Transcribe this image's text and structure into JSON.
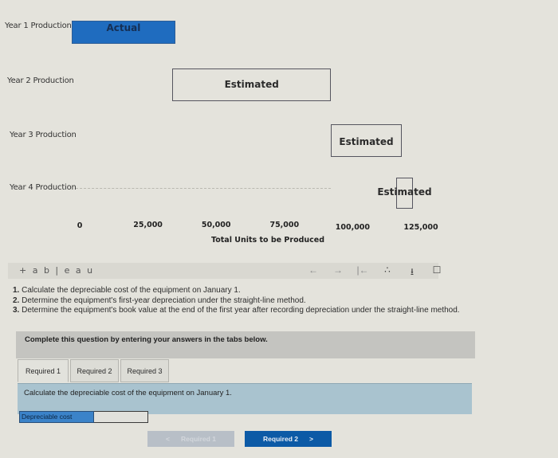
{
  "chart_data": {
    "type": "gantt",
    "title": "",
    "xlabel": "Total Units to be Produced",
    "ylabel": "",
    "xlim": [
      0,
      125000
    ],
    "x_ticks": [
      0,
      25000,
      50000,
      75000,
      100000,
      125000
    ],
    "x_tick_labels": [
      "0",
      "25,000",
      "50,000",
      "75,000",
      "100,000",
      "125,000"
    ],
    "categories": [
      "Year 1 Production",
      "Year 2 Production",
      "Year 3 Production",
      "Year 4 Production"
    ],
    "series": [
      {
        "category": "Year 1 Production",
        "label": "Actual",
        "start": 0,
        "end": 35000,
        "color": "#1f6cbf"
      },
      {
        "category": "Year 2 Production",
        "label": "Estimated",
        "start": 34000,
        "end": 92000,
        "color": "none"
      },
      {
        "category": "Year 3 Production",
        "label": "Estimated",
        "start": 92000,
        "end": 118000,
        "color": "none"
      },
      {
        "category": "Year 4 Production",
        "label": "Estimated",
        "start": 116000,
        "end": 122000,
        "color": "none"
      }
    ],
    "grid": false,
    "legend": "none"
  },
  "tableau": {
    "logo_text": "+ a b | e a u",
    "toolbar": [
      {
        "name": "undo-icon",
        "glyph": "←"
      },
      {
        "name": "redo-icon",
        "glyph": "→"
      },
      {
        "name": "revert-icon",
        "glyph": "|←"
      },
      {
        "name": "share-icon",
        "glyph": "∴"
      },
      {
        "name": "download-icon",
        "glyph": "⭳"
      },
      {
        "name": "fullscreen-icon",
        "glyph": "☐"
      }
    ]
  },
  "questions": [
    {
      "num": "1.",
      "text": "Calculate the depreciable cost of the equipment on January 1."
    },
    {
      "num": "2.",
      "text": "Determine the equipment's first-year depreciation under the straight-line method."
    },
    {
      "num": "3.",
      "text": "Determine the equipment's book value at the end of the first year after recording depreciation under the straight-line method."
    }
  ],
  "instruction": "Complete this question by entering your answers in the tabs below.",
  "tabs": [
    {
      "label": "Required 1",
      "active": true
    },
    {
      "label": "Required 2",
      "active": false
    },
    {
      "label": "Required 3",
      "active": false
    }
  ],
  "question_panel": "Calculate the depreciable cost of the equipment on January 1.",
  "answer": {
    "label": "Depreciable cost",
    "value": ""
  },
  "nav": {
    "prev_label": "Required 1",
    "prev_glyph": "<",
    "next_label": "Required 2",
    "next_glyph": ">"
  }
}
